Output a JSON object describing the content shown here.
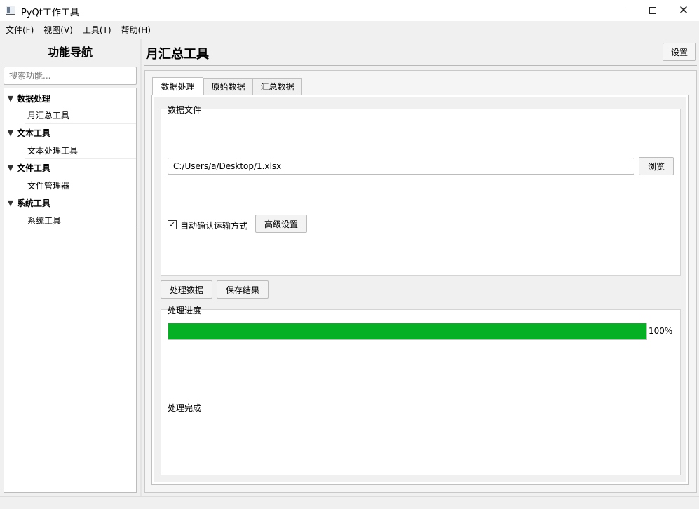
{
  "window": {
    "title": "PyQt工作工具",
    "minimize_glyph": "",
    "close_glyph": "✕"
  },
  "menu": [
    {
      "label": "文件(F)"
    },
    {
      "label": "视图(V)"
    },
    {
      "label": "工具(T)"
    },
    {
      "label": "帮助(H)"
    }
  ],
  "sidebar": {
    "title": "功能导航",
    "search_placeholder": "搜索功能...",
    "categories": [
      {
        "label": "数据处理",
        "expanded": true,
        "children": [
          {
            "label": "月汇总工具"
          }
        ]
      },
      {
        "label": "文本工具",
        "expanded": true,
        "children": [
          {
            "label": "文本处理工具"
          }
        ]
      },
      {
        "label": "文件工具",
        "expanded": true,
        "children": [
          {
            "label": "文件管理器"
          }
        ]
      },
      {
        "label": "系统工具",
        "expanded": true,
        "children": [
          {
            "label": "系统工具"
          }
        ]
      }
    ],
    "chevron_icon": "chevron-down-icon"
  },
  "main": {
    "title": "月汇总工具",
    "settings_label": "设置",
    "tabs": [
      {
        "label": "数据处理",
        "active": true
      },
      {
        "label": "原始数据",
        "active": false
      },
      {
        "label": "汇总数据",
        "active": false
      }
    ],
    "data_file": {
      "group_label": "数据文件",
      "path_value": "C:/Users/a/Desktop/1.xlsx",
      "browse_label": "浏览",
      "auto_confirm_label": "自动确认运输方式",
      "auto_confirm_checked": true,
      "check_glyph": "✓",
      "advanced_label": "高级设置"
    },
    "actions": {
      "process_label": "处理数据",
      "save_label": "保存结果"
    },
    "progress": {
      "group_label": "处理进度",
      "percent": 100,
      "percent_text": "100%",
      "bar_color": "#06b025",
      "status_text": "处理完成"
    }
  }
}
